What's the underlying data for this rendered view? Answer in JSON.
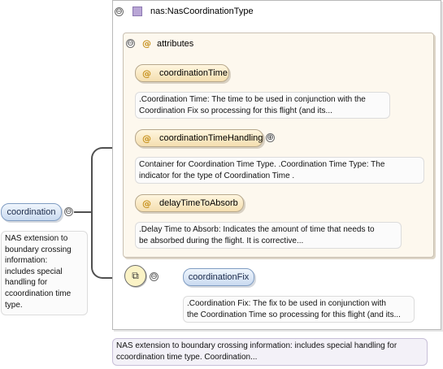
{
  "type_box": {
    "collapse_symbol": "⊖",
    "type_icon": "complex-type-icon",
    "title": "nas:NasCoordinationType"
  },
  "attributes_group": {
    "collapse_symbol": "⊖",
    "at_symbol": "@",
    "label": "attributes"
  },
  "attributes": [
    {
      "name": "coordinationTime",
      "expand_symbol": "",
      "description_lines": [
        ".Coordination Time: The time to be used in conjunction with the",
        "Coordination Fix so processing for this flight (and its..."
      ]
    },
    {
      "name": "coordinationTimeHandling",
      "expand_symbol": "⊕",
      "description_lines": [
        "Container for Coordination Time Type. .Coordination Time Type: The",
        "indicator for the type of Coordination Time ."
      ]
    },
    {
      "name": "delayTimeToAbsorb",
      "expand_symbol": "",
      "description_lines": [
        ".Delay Time to Absorb: Indicates the amount of time that needs to",
        "be absorbed during the flight. It is corrective..."
      ]
    }
  ],
  "root_element": {
    "name": "coordination",
    "collapse_symbol": "⊖",
    "description_lines": [
      "NAS extension to",
      "boundary crossing",
      "information:",
      "includes special",
      "handling for",
      "ccoordination time",
      "type."
    ]
  },
  "sequence": {
    "symbol": "⧉",
    "collapse_symbol": "⊖"
  },
  "child_element": {
    "name": "coordinationFix",
    "description_lines": [
      ".Coordination Fix: The fix to be used in conjunction with",
      "the Coordination Time so processing for this flight (and its..."
    ]
  },
  "type_description_lines": [
    "NAS extension to boundary crossing information: includes special handling for",
    "ccoordination time type. Coordination..."
  ]
}
